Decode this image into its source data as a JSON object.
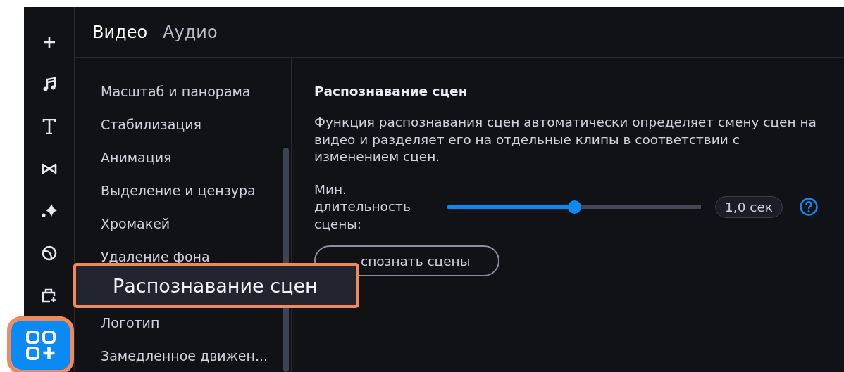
{
  "rail_items": [
    {
      "selected": false,
      "highlighted": false
    },
    {
      "selected": false,
      "highlighted": false
    },
    {
      "selected": false,
      "highlighted": false
    },
    {
      "selected": false,
      "highlighted": false
    },
    {
      "selected": false,
      "highlighted": false
    },
    {
      "selected": false,
      "highlighted": false
    },
    {
      "selected": false,
      "highlighted": false
    },
    {
      "selected": true,
      "highlighted": true
    }
  ],
  "tabs": [
    {
      "label": "Видео",
      "selected": true
    },
    {
      "label": "Аудио",
      "selected": false
    }
  ],
  "tools_top": [
    "Масштаб и панорама",
    "Стабилизация",
    "Анимация",
    "Выделение и цензура",
    "Хромакей",
    "Удаление фона"
  ],
  "tools_bottom": [
    "Логотип",
    "Замедленное движен..."
  ],
  "callout": {
    "label": "Распознавание сцен",
    "highlighted": true
  },
  "panel": {
    "heading": "Распознавание сцен",
    "description": "Функция распознавания сцен автоматически определяет смену сцен на видео и разделяет его на отдельные клипы в соответствии с изменением сцен.",
    "setting_label": "Мин. длительность сцены:",
    "slider": {
      "level": 0.5
    },
    "value": "1,0 сек",
    "button": "спознать сцены"
  }
}
